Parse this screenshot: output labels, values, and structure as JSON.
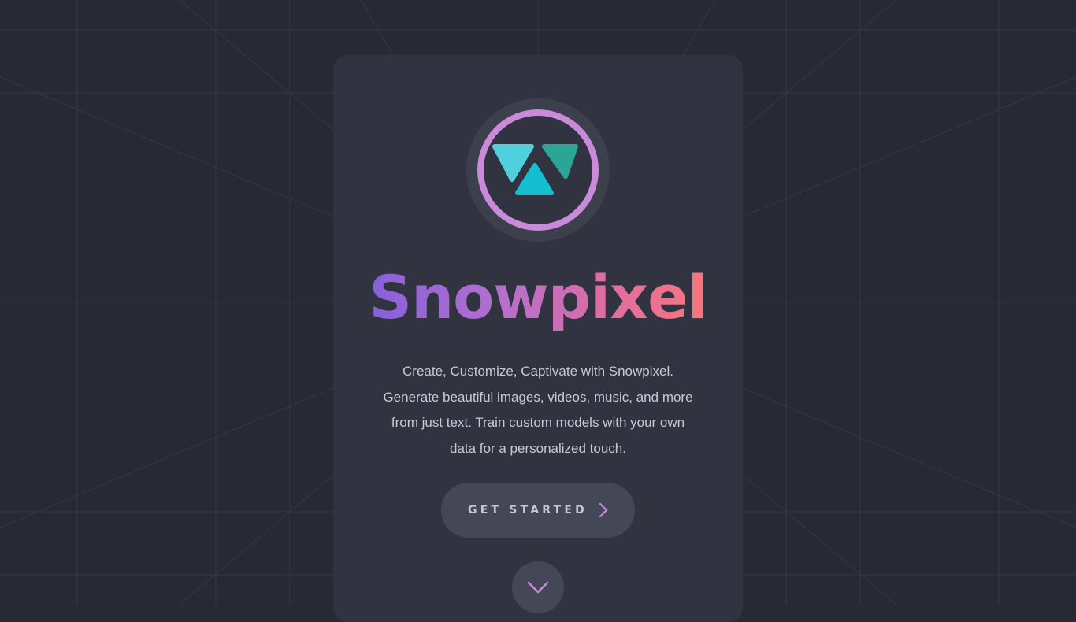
{
  "brand": {
    "name": "Snowpixel",
    "logo_icon": "snowpixel-logo-icon"
  },
  "hero": {
    "tagline": "Create, Customize, Captivate with Snowpixel. Generate beautiful images, videos, music, and more from just text. Train custom models with your own data for a personalized touch."
  },
  "cta": {
    "label": "GET STARTED",
    "icon": "chevron-right-icon"
  },
  "scroll": {
    "icon": "chevron-down-icon"
  },
  "colors": {
    "background": "#272a35",
    "card": "#313440",
    "button": "#444755",
    "logo_ring": "#c98ad9",
    "accent_teal": "#20b8c8",
    "gradient_start": "#7a5cde",
    "gradient_end": "#ff7a6e"
  }
}
